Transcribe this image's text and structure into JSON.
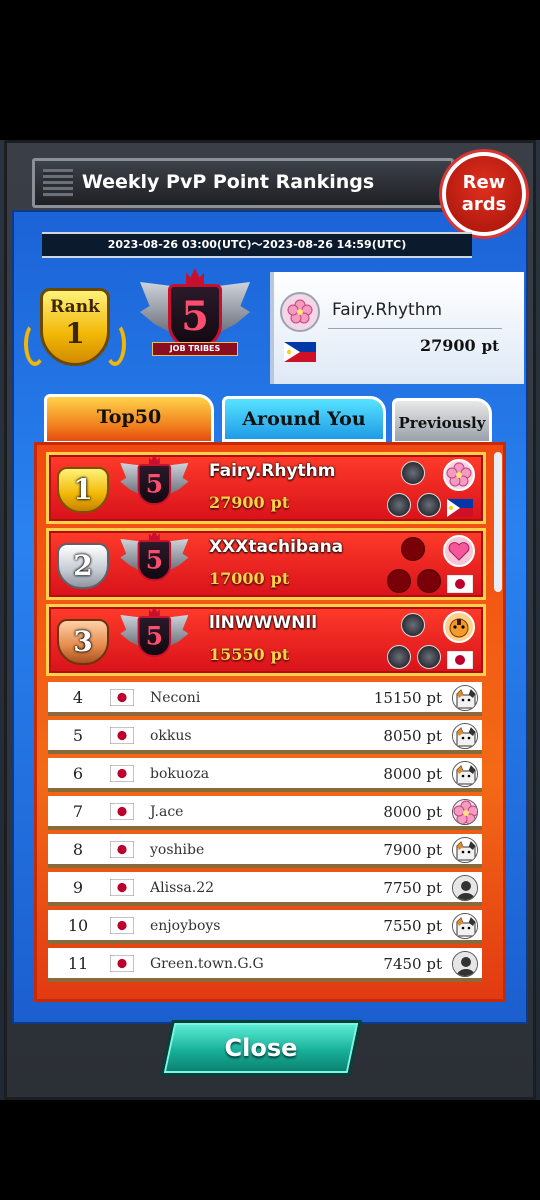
{
  "header": {
    "title": "Weekly PvP Point Rankings",
    "rewards_line1": "Rew",
    "rewards_line2": "ards",
    "period": "2023-08-26 03:00(UTC)～2023-08-26 14:59(UTC)"
  },
  "me": {
    "rank_label": "Rank",
    "rank": "1",
    "emblem_level": "5",
    "emblem_text": "JOB TRIBES",
    "name": "Fairy.Rhythm",
    "points": "27900",
    "points_unit": "pt",
    "flag": "PH"
  },
  "tabs": [
    {
      "label": "Top50",
      "active": true
    },
    {
      "label": "Around You",
      "active": false
    },
    {
      "label": "Previously",
      "active": false
    }
  ],
  "top3": [
    {
      "rank": "1",
      "name": "Fairy.Rhythm",
      "points": "27900",
      "unit": "pt",
      "flag": "PH",
      "medal": "gold"
    },
    {
      "rank": "2",
      "name": "XXXtachibana",
      "points": "17000",
      "unit": "pt",
      "flag": "JP",
      "medal": "silver"
    },
    {
      "rank": "3",
      "name": "llNWWWNll",
      "points": "15550",
      "unit": "pt",
      "flag": "JP",
      "medal": "bronze"
    }
  ],
  "rows": [
    {
      "rank": "4",
      "name": "Neconi",
      "points": "15150 pt",
      "avatar": "cat-icon"
    },
    {
      "rank": "5",
      "name": "okkus",
      "points": "8050 pt",
      "avatar": "cat-icon"
    },
    {
      "rank": "6",
      "name": "bokuoza",
      "points": "8000 pt",
      "avatar": "cat-icon"
    },
    {
      "rank": "7",
      "name": "J.ace",
      "points": "8000 pt",
      "avatar": "flower-icon"
    },
    {
      "rank": "8",
      "name": "yoshibe",
      "points": "7900 pt",
      "avatar": "cat-icon"
    },
    {
      "rank": "9",
      "name": "Alissa.22",
      "points": "7750 pt",
      "avatar": "default-user-icon"
    },
    {
      "rank": "10",
      "name": "enjoyboys",
      "points": "7550 pt",
      "avatar": "cat-icon"
    },
    {
      "rank": "11",
      "name": "Green.town.G.G",
      "points": "7450 pt",
      "avatar": "default-user-icon"
    }
  ],
  "close_label": "Close",
  "colors": {
    "accent_red": "#d8121a",
    "gold": "#ffd24a",
    "blue": "#1b63d6",
    "teal": "#17b09a"
  }
}
